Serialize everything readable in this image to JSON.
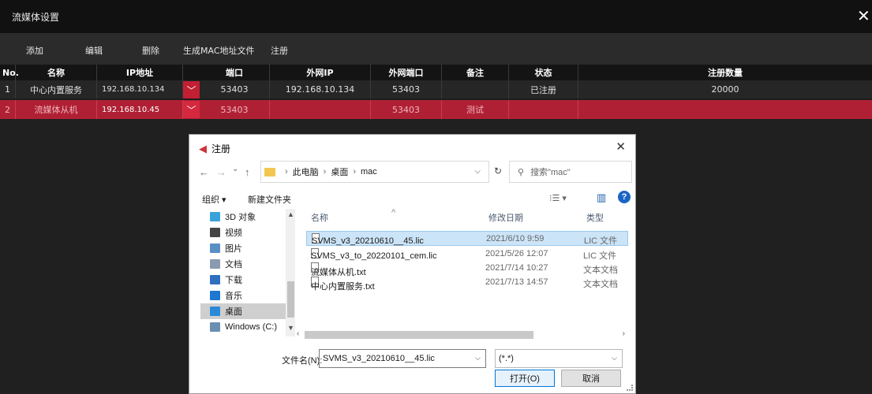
{
  "window": {
    "title": "流媒体设置",
    "close": "✕"
  },
  "toolbar": {
    "add": "添加",
    "edit": "编辑",
    "delete": "删除",
    "gen_mac": "生成MAC地址文件",
    "register": "注册"
  },
  "table": {
    "headers": {
      "no": "No.",
      "name": "名称",
      "ip": "IP地址",
      "port": "端口",
      "ext_ip": "外网IP",
      "ext_port": "外网端口",
      "remark": "备注",
      "status": "状态",
      "reg_count": "注册数量"
    },
    "rows": [
      {
        "no": "1",
        "name": "中心内置服务",
        "ip": "192.168.10.134",
        "port": "53403",
        "ext_ip": "192.168.10.134",
        "ext_port": "53403",
        "remark": "",
        "status": "已注册",
        "reg_count": "20000"
      },
      {
        "no": "2",
        "name": "流媒体从机",
        "ip": "192.168.10.45",
        "port": "53403",
        "ext_ip": "",
        "ext_port": "53403",
        "remark": "测试",
        "status": "",
        "reg_count": ""
      }
    ],
    "dropdown_glyph": "﹀"
  },
  "dialog": {
    "title": "注册",
    "close": "✕",
    "nav": {
      "back": "←",
      "forward": "→",
      "recent": "⌄",
      "up": "↑"
    },
    "breadcrumb": [
      "此电脑",
      "桌面",
      "mac"
    ],
    "sep": "›",
    "search_placeholder": "搜索\"mac\"",
    "organize": "组织 ▾",
    "new_folder": "新建文件夹",
    "view_icons": [
      "⁝☰ ▾",
      "▥"
    ],
    "help": "?",
    "nav_items": [
      {
        "label": "3D 对象",
        "color": "#38a3d9"
      },
      {
        "label": "视频",
        "color": "#444444"
      },
      {
        "label": "图片",
        "color": "#5a8fc6"
      },
      {
        "label": "文档",
        "color": "#8a9ab0"
      },
      {
        "label": "下载",
        "color": "#2f6fc0"
      },
      {
        "label": "音乐",
        "color": "#1e78d2"
      },
      {
        "label": "桌面",
        "color": "#2a8ad8"
      },
      {
        "label": "Windows (C:)",
        "color": "#6a8fb0"
      }
    ],
    "columns": {
      "name": "名称",
      "date": "修改日期",
      "type": "类型"
    },
    "files": [
      {
        "name": "SVMS_v3_20210610__45.lic",
        "date": "2021/6/10 9:59",
        "type": "LIC 文件"
      },
      {
        "name": "SVMS_v3_to_20220101_cem.lic",
        "date": "2021/5/26 12:07",
        "type": "LIC 文件"
      },
      {
        "name": "流媒体从机.txt",
        "date": "2021/7/14 10:27",
        "type": "文本文档"
      },
      {
        "name": "中心内置服务.txt",
        "date": "2021/7/13 14:57",
        "type": "文本文档"
      }
    ],
    "filename_label": "文件名(N):",
    "filename_value": "SVMS_v3_20210610__45.lic",
    "filter_value": "(*.*)",
    "open_button": "打开(O)",
    "cancel_button": "取消"
  }
}
